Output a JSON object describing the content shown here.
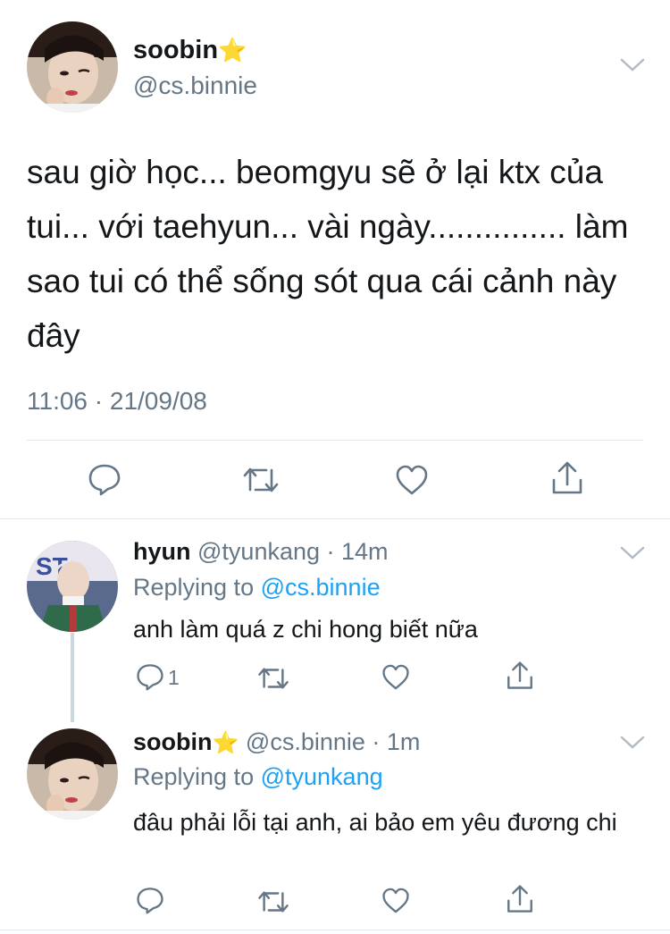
{
  "main_tweet": {
    "display_name": "soobin",
    "star": "⭐",
    "handle": "@cs.binnie",
    "text": "sau giờ học... beomgyu sẽ ở lại ktx của tui... với taehyun... vài ngày............... làm sao tui có thể sống sót qua cái cảnh này đây",
    "timestamp": "11:06 · 21/09/08"
  },
  "replies": [
    {
      "display_name": "hyun",
      "star": "",
      "handle": "@tyunkang",
      "time": "· 14m",
      "replying_label": "Replying to",
      "replying_to": "@cs.binnie",
      "text": "anh làm quá z chi hong biết nữa",
      "reply_count": "1"
    },
    {
      "display_name": "soobin",
      "star": "⭐",
      "handle": "@cs.binnie",
      "time": "· 1m",
      "replying_label": "Replying to",
      "replying_to": "@tyunkang",
      "text": "đâu phải lỗi tại anh, ai bảo em yêu đương chi",
      "reply_count": ""
    }
  ],
  "icons": [
    "reply-icon",
    "retweet-icon",
    "like-icon",
    "share-icon",
    "chevron-down-icon",
    "star-icon"
  ],
  "colors": {
    "link": "#1da1f2",
    "muted": "#657786",
    "icon": "#657786",
    "divider": "#e1e8ed",
    "star": "#f5c518"
  }
}
